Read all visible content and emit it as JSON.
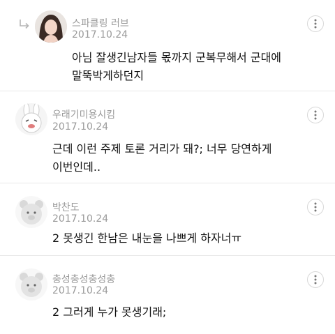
{
  "comments": [
    {
      "author": "스파클링 러브",
      "date": "2017.10.24",
      "text": "아님 잘생긴남자들 몫까지 군복무해서 군대에\n말뚝박게하던지",
      "avatar": "photo-avatar",
      "is_reply": true
    },
    {
      "author": "우래기미용시킴",
      "date": "2017.10.24",
      "text": "근데 이런 주제 토론 거리가 돼?; 너무 당연하게\n이번인데..",
      "avatar": "bunny-avatar"
    },
    {
      "author": "박찬도",
      "date": "2017.10.24",
      "text": "2 못생긴 한남은 내눈을 나쁘게 하자너ㅠ",
      "avatar": "bear-avatar"
    },
    {
      "author": "충성충성충성충",
      "date": "2017.10.24",
      "text": "2 그러게 누가 못생기래;",
      "avatar": "bear-avatar"
    }
  ],
  "icons": {
    "more": "more-vertical-icon",
    "reply": "reply-arrow-icon"
  },
  "colors": {
    "meta_text": "#9a9a9a",
    "divider": "#e8e8e8"
  }
}
